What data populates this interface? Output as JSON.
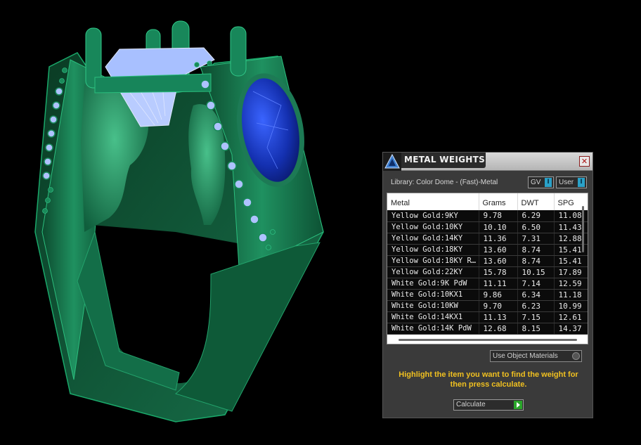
{
  "panel": {
    "title": "METAL WEIGHTS",
    "close_symbol": "✕",
    "library_label": "Library: Color Dome - (Fast)-Metal",
    "gv_label": "GV",
    "user_label": "User",
    "indicator_symbol": "I",
    "table": {
      "columns": [
        "Metal",
        "Grams",
        "DWT",
        "SPG"
      ],
      "rows": [
        [
          "Yellow Gold:9KY",
          "9.78",
          "6.29",
          "11.08"
        ],
        [
          "Yellow Gold:10KY",
          "10.10",
          "6.50",
          "11.43"
        ],
        [
          "Yellow Gold:14KY",
          "11.36",
          "7.31",
          "12.88"
        ],
        [
          "Yellow Gold:18KY",
          "13.60",
          "8.74",
          "15.41"
        ],
        [
          "Yellow Gold:18KY R...",
          "13.60",
          "8.74",
          "15.41"
        ],
        [
          "Yellow Gold:22KY",
          "15.78",
          "10.15",
          "17.89"
        ],
        [
          "White Gold:9K PdW",
          "11.11",
          "7.14",
          "12.59"
        ],
        [
          "White Gold:10KX1",
          "9.86",
          "6.34",
          "11.18"
        ],
        [
          "White Gold:10KW",
          "9.70",
          "6.23",
          "10.99"
        ],
        [
          "White Gold:14KX1",
          "11.13",
          "7.15",
          "12.61"
        ],
        [
          "White Gold:14K PdW",
          "12.68",
          "8.15",
          "14.37"
        ]
      ]
    },
    "use_object_materials_label": "Use Object Materials",
    "instructions": "Highlight the item you want to find the weight for then press calculate.",
    "calculate_label": "Calculate"
  },
  "colors": {
    "background": "#000000",
    "ring_metal": "#1a8a5a",
    "stone_blue": "#1030c8",
    "diamond": "#a8c0ff",
    "instruction_text": "#f0c020",
    "indicator": "#2aa1c8",
    "calculate_go": "#2aa52a"
  },
  "icons": {
    "panel_logo": "triangle-logo-icon",
    "close": "close-icon",
    "calculate": "play-arrow-icon"
  }
}
